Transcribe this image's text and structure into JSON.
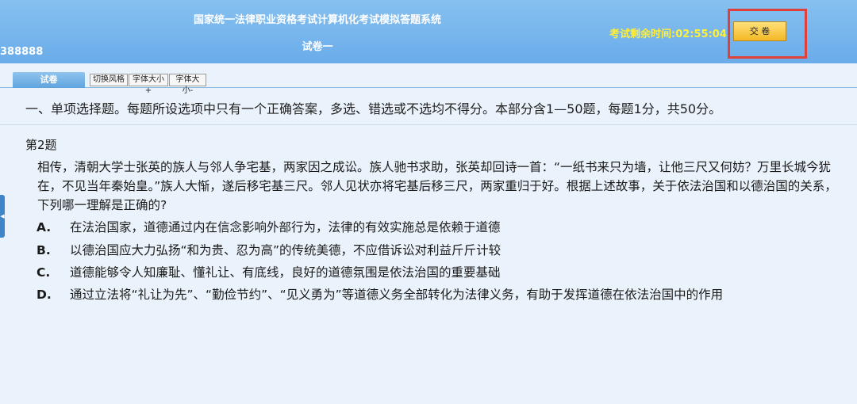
{
  "header": {
    "system_title": "国家统一法律职业资格考试计算机化考试模拟答题系统",
    "paper_name": "试卷一",
    "candidate_id": "388888",
    "timer_label": "考试剩余时间:",
    "timer_value": "02:55:04",
    "submit_label": "交 卷"
  },
  "toolbar": {
    "tab_label": "试卷",
    "buttons": [
      "切换风格",
      "字体大小+",
      "字体大小-"
    ]
  },
  "section_instruction": "一、单项选择题。每题所设选项中只有一个正确答案，多选、错选或不选均不得分。本部分含1—50题，每题1分，共50分。",
  "question": {
    "number_label": "第2题",
    "stem": "相传，清朝大学士张英的族人与邻人争宅基，两家因之成讼。族人驰书求助，张英却回诗一首：“一纸书来只为墙，让他三尺又何妨？万里长城今犹在，不见当年秦始皇。”族人大惭，遂后移宅基三尺。邻人见状亦将宅基后移三尺，两家重归于好。根据上述故事，关于依法治国和以德治国的关系，下列哪一理解是正确的?",
    "options": [
      {
        "key": "A.",
        "text": "在法治国家，道德通过内在信念影响外部行为，法律的有效实施总是依赖于道德"
      },
      {
        "key": "B.",
        "text": "以德治国应大力弘扬“和为贵、忍为高”的传统美德，不应借诉讼对利益斤斤计较"
      },
      {
        "key": "C.",
        "text": "道德能够令人知廉耻、懂礼让、有底线，良好的道德氛围是依法治国的重要基础"
      },
      {
        "key": "D.",
        "text": "通过立法将“礼让为先”、“勤俭节约”、“见义勇为”等道德义务全部转化为法律义务，有助于发挥道德在依法治国中的作用"
      }
    ]
  },
  "colors": {
    "header": "#6aacea",
    "timer": "#ffef3a",
    "submit_button": "#f3b824",
    "highlight_frame": "#e0403a",
    "page_background": "#eaf3fb"
  }
}
